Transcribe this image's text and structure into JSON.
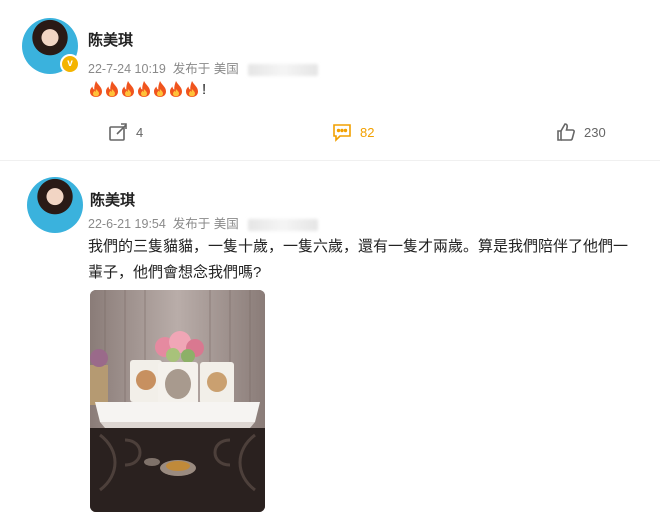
{
  "post1": {
    "username": "陈美琪",
    "time": "22-7-24 10:19",
    "source": "发布于 美国",
    "content_suffix": "!",
    "fire_count": 7,
    "actions": {
      "repost": "4",
      "comment": "82",
      "like": "230"
    }
  },
  "post2": {
    "username": "陈美琪",
    "time": "22-6-21 19:54",
    "source": "发布于 美国",
    "text": "我們的三隻貓貓，一隻十歲，一隻六歲，還有一隻才兩歲。算是我們陪伴了他們一輩子，他們會想念我們嗎?"
  },
  "icons": [
    "verified-badge-icon",
    "fire-emoji-icon",
    "repost-icon",
    "comment-icon",
    "like-icon"
  ],
  "colors": {
    "comment_accent": "#f2a000",
    "verified": "#f4b400",
    "meta": "#8a8a8a"
  }
}
